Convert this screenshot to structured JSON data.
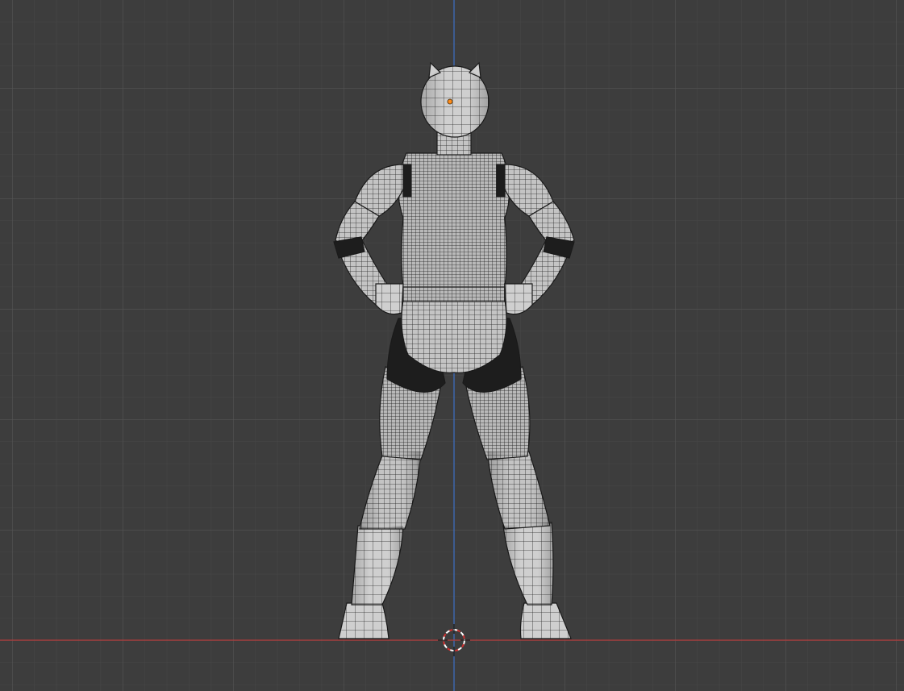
{
  "viewport": {
    "view": "front-orthographic",
    "shading": "solid-wireframe-overlay",
    "object": "character-mesh",
    "background_color": "#3d3d3d",
    "grid_minor_color": "#464646",
    "grid_major_color": "#555555",
    "axis_x_color": "#b53c3c",
    "axis_z_color": "#3b6fc4",
    "mesh_fill_color": "#bdbdbd",
    "mesh_wire_color": "#1c1c1c",
    "origin_color": "#ff8c1a",
    "cursor_icon": "3d-cursor-icon"
  }
}
